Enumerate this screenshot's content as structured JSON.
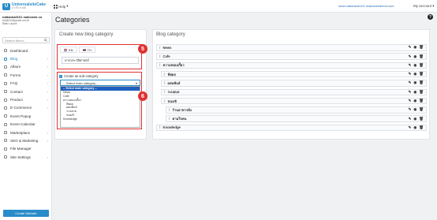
{
  "topbar": {
    "logo_name": "UniversalsiteCake",
    "logo_tagline": "มา เก็บ ขายดี",
    "logo_mark": "U",
    "help_label": "Help",
    "url_text": "www.nattanka0101.makewebdirect.com",
    "account_label": "My account"
  },
  "sidebar": {
    "email": "nattanka0101 makeweb co",
    "line2": "tr[n]A010@gmail.com.th",
    "line3": "Basic Layout",
    "search_placeholder": "Search Menu...",
    "items": [
      {
        "label": "Dashboard",
        "active": false,
        "chevron": false
      },
      {
        "label": "Blog",
        "active": true,
        "chevron": true
      },
      {
        "label": "Album",
        "active": false,
        "chevron": true
      },
      {
        "label": "Forms",
        "active": false,
        "chevron": true
      },
      {
        "label": "FAQ",
        "active": false,
        "chevron": true
      },
      {
        "label": "Contact",
        "active": false,
        "chevron": true
      },
      {
        "label": "Product",
        "active": false,
        "chevron": true
      },
      {
        "label": "E-Commerce",
        "active": false,
        "chevron": true
      },
      {
        "label": "Event Popup",
        "active": false,
        "chevron": false
      },
      {
        "label": "Event Calendar",
        "active": false,
        "chevron": false
      },
      {
        "label": "Marketplace",
        "active": false,
        "chevron": true
      },
      {
        "label": "SEO & Marketing",
        "active": false,
        "chevron": true
      },
      {
        "label": "File Manager",
        "active": false,
        "chevron": false
      },
      {
        "label": "Site Settings",
        "active": false,
        "chevron": true
      }
    ],
    "create_button": "Create Website"
  },
  "page": {
    "title": "Categories",
    "help_glyph": "?"
  },
  "create_panel": {
    "title": "Create new blog category",
    "tabs": [
      {
        "label": "EN",
        "flag": "flag-en"
      },
      {
        "label": "TH",
        "flag": "flag-th"
      }
    ],
    "name_value": "หากประวัติศาสตร์",
    "badge_top": "5",
    "badge_bottom": "6",
    "sub_category_label": "Create as sub-category",
    "select_value": "-- Select main category --",
    "dropdown_options": [
      {
        "label": "-- Select main category --",
        "level": 0,
        "selected": true
      },
      {
        "label": "News",
        "level": 0,
        "selected": false
      },
      {
        "label": "Cafe",
        "level": 0,
        "selected": false
      },
      {
        "label": "ความหอมเกี้ยว",
        "level": 0,
        "selected": false
      },
      {
        "label": "ฟัยผล",
        "level": 1,
        "selected": false
      },
      {
        "label": "ผสมพันธ์",
        "level": 1,
        "selected": false
      },
      {
        "label": "ระบอบล",
        "level": 1,
        "selected": false
      },
      {
        "label": "ขนมชิ",
        "level": 1,
        "selected": false
      },
      {
        "label": "Knowledge",
        "level": 0,
        "selected": false
      }
    ]
  },
  "category_panel": {
    "title": "Blog category",
    "rows": [
      {
        "label": "News",
        "indent": 0
      },
      {
        "label": "Cafe",
        "indent": 0
      },
      {
        "label": "ความหอมเกี้ยว",
        "indent": 0
      },
      {
        "label": "ฟัยผล",
        "indent": 1
      },
      {
        "label": "ผสมพันธ์",
        "indent": 1
      },
      {
        "label": "ระบอบล",
        "indent": 1
      },
      {
        "label": "ขนมชิ",
        "indent": 1
      },
      {
        "label": "ร้านอาหารดัง",
        "indent": 2
      },
      {
        "label": "ตามใจคน",
        "indent": 2
      },
      {
        "label": "Knowledge",
        "indent": 0
      }
    ]
  },
  "colors": {
    "accent": "#2a8cc8",
    "annotation": "#e03131",
    "selected_option": "#1f5fbf"
  }
}
